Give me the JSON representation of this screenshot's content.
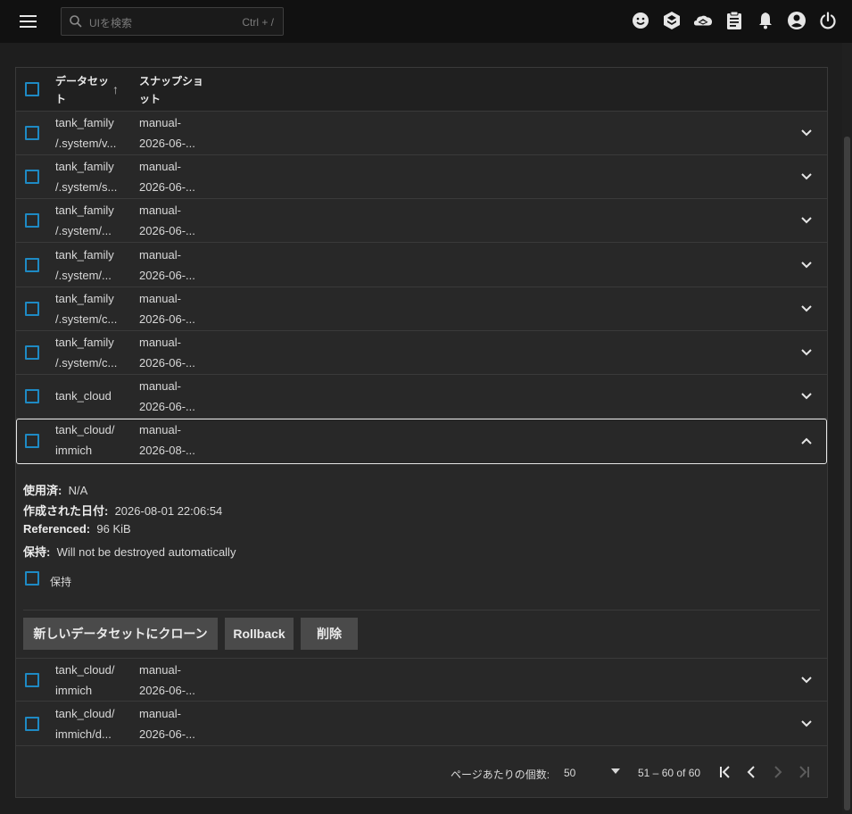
{
  "search": {
    "placeholder": "UIを検索",
    "shortcut": "Ctrl + /"
  },
  "topbar": {
    "icons": [
      "smile-icon",
      "truecommand-icon",
      "cloud-sync-icon",
      "clipboard-tasks-icon",
      "bell-icon",
      "account-circle-icon",
      "power-icon"
    ]
  },
  "table": {
    "headers": {
      "dataset": "データセット",
      "snapshot": "スナップショット"
    },
    "rows": [
      {
        "dataset": "tank_family\n/.system/v...",
        "snapshot": "manual-\n2026-06-..."
      },
      {
        "dataset": "tank_family\n/.system/s...",
        "snapshot": "manual-\n2026-06-..."
      },
      {
        "dataset": "tank_family\n/.system/...",
        "snapshot": "manual-\n2026-06-..."
      },
      {
        "dataset": "tank_family\n/.system/...",
        "snapshot": "manual-\n2026-06-..."
      },
      {
        "dataset": "tank_family\n/.system/c...",
        "snapshot": "manual-\n2026-06-..."
      },
      {
        "dataset": "tank_family\n/.system/c...",
        "snapshot": "manual-\n2026-06-..."
      },
      {
        "dataset": "tank_cloud",
        "snapshot": "manual-\n2026-06-..."
      },
      {
        "dataset": "tank_cloud/\nimmich",
        "snapshot": "manual-\n2026-08-..."
      },
      {
        "dataset": "tank_cloud/\nimmich",
        "snapshot": "manual-\n2026-06-..."
      },
      {
        "dataset": "tank_cloud/\nimmich/d...",
        "snapshot": "manual-\n2026-06-..."
      }
    ]
  },
  "detail": {
    "used_label": "使用済:",
    "used_value": "N/A",
    "created_label": "作成された日付:",
    "created_value": "2026-08-01 22:06:54",
    "referenced_label": "Referenced:",
    "referenced_value": "96 KiB",
    "hold_label": "保持:",
    "hold_value": "Will not be destroyed automatically",
    "hold_checkbox_label": "保持",
    "buttons": {
      "clone": "新しいデータセットにクローン",
      "rollback": "Rollback",
      "delete": "削除"
    }
  },
  "pager": {
    "per_page_label": "ページあたりの個数:",
    "per_page_value": "50",
    "range": "51 – 60 of 60"
  },
  "colors": {
    "accent": "#1e8ac4",
    "background": "#1e1e1e",
    "card": "#282828",
    "topbar": "#111111"
  }
}
